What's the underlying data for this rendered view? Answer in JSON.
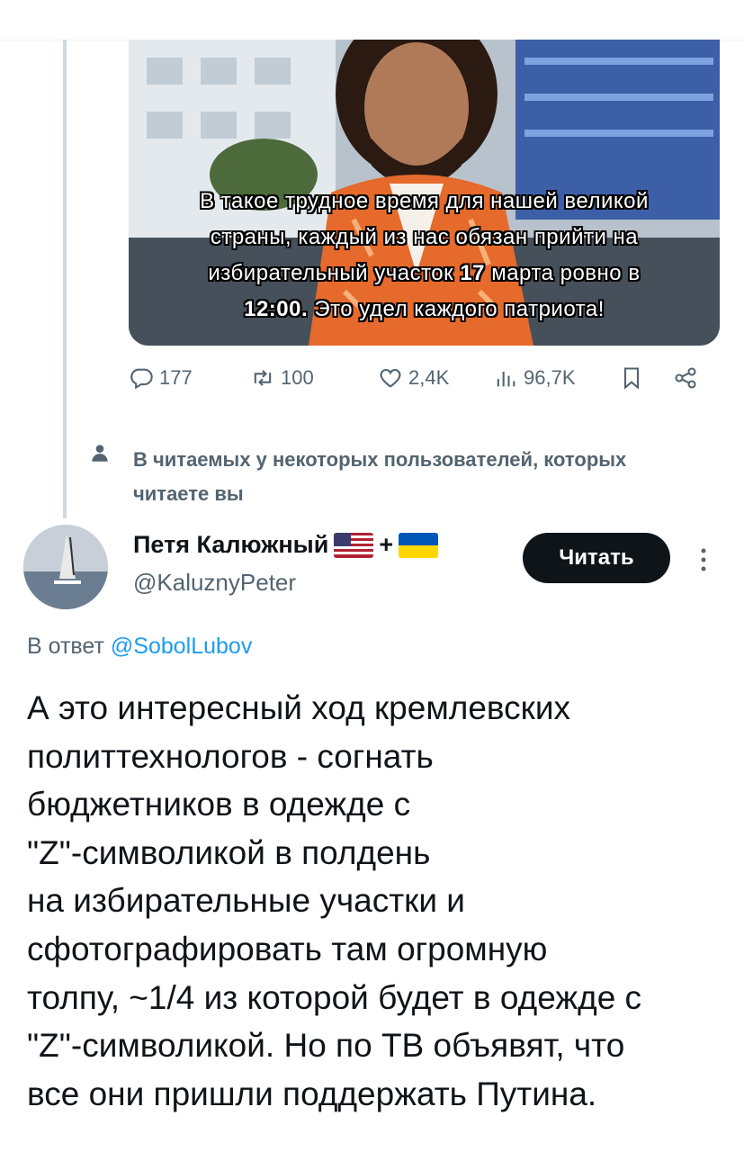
{
  "tweet_image": {
    "caption_lines": [
      "В такое трудное время для нашей великой",
      "страны, каждый из нас обязан прийти на",
      "избирательный участок 17 марта ровно в",
      "12:00. Это удел каждого патриота!"
    ],
    "caption_parts": {
      "l1": "В такое трудное время для нашей великой",
      "l2": "страны, каждый из нас обязан прийти на",
      "l3a": "избирательный участок ",
      "l3b": "17",
      "l3c": " марта ровно в",
      "l4a": "12:00.",
      "l4b": " Это удел каждого патриота!"
    }
  },
  "actions": {
    "replies": "177",
    "reposts": "100",
    "likes": "2,4K",
    "views": "96,7K"
  },
  "social_context": "В читаемых у некоторых пользователей, которых читаете вы",
  "author": {
    "name": "Петя Калюжный",
    "flags": [
      "us-flag",
      "+",
      "ua-flag"
    ],
    "plus": "+",
    "handle": "@KaluznyPeter",
    "follow_label": "Читать"
  },
  "reply_to": {
    "prefix": "В ответ ",
    "handle": "@SobolLubov"
  },
  "tweet_text": "А это интересный ход кремлевских\nполиттехнологов - согнать\nбюджетников в одежде с\n\"Z\"-символикой в полдень\nна избирательные участки и\nсфотографировать там  огромную\nтолпу, ~1/4 из которой будет в одежде с\n\"Z\"-символикой. Но по ТВ объявят, что\nвсе они  пришли поддержать Путина.",
  "colors": {
    "accent": "#1d9bf0",
    "secondary_text": "#536471",
    "primary_text": "#0f1419",
    "caption_border": "#000000"
  },
  "icons": [
    "reply-icon",
    "repost-icon",
    "like-icon",
    "views-icon",
    "bookmark-icon",
    "share-icon",
    "person-icon",
    "more-icon"
  ]
}
